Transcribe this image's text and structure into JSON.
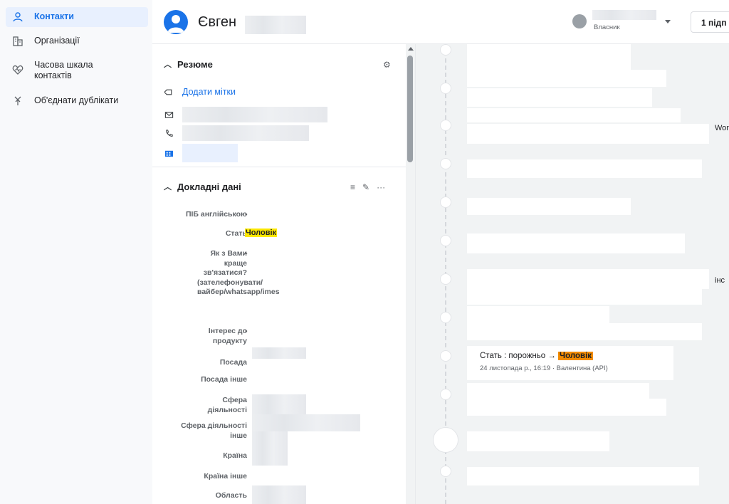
{
  "sidebar": {
    "items": [
      {
        "label": "Контакти",
        "icon": "person-icon"
      },
      {
        "label": "Організації",
        "icon": "building-icon"
      },
      {
        "label": "Часова шкала контактів",
        "icon": "heartbeat-icon"
      },
      {
        "label": "Об'єднати дублікати",
        "icon": "merge-icon"
      }
    ]
  },
  "header": {
    "name": "Євген",
    "owner_label": "Власник",
    "follow_label": "1 підп"
  },
  "summary": {
    "title": "Резюме",
    "add_tags": "Додати мітки"
  },
  "details": {
    "title": "Докладні дані",
    "fields": [
      {
        "label": "ПІБ англійською",
        "value": "-"
      },
      {
        "label": "Стать",
        "value": "Чоловік"
      },
      {
        "label": "Як з Вами краще зв'язатися? (зателефонувати/ вайбер/whatsapp/imes",
        "value": "-"
      },
      {
        "label": "Інтерес до продукту",
        "value": "-"
      },
      {
        "label": "Посада",
        "value": ""
      },
      {
        "label": "Посада інше",
        "value": ""
      },
      {
        "label": "Сфера діяльності",
        "value": ""
      },
      {
        "label": "Сфера діяльності інше",
        "value": ""
      },
      {
        "label": "Країна",
        "value": ""
      },
      {
        "label": "Країна інше",
        "value": ""
      },
      {
        "label": "Область",
        "value": ""
      }
    ]
  },
  "timeline": {
    "event": {
      "prefix": "Стать : порожньо →",
      "new_value": "Чоловік",
      "meta": "24 листопада р., 16:19 · Валентина (API)"
    },
    "cut_text_1": "Wor",
    "cut_text_2": "інс"
  }
}
